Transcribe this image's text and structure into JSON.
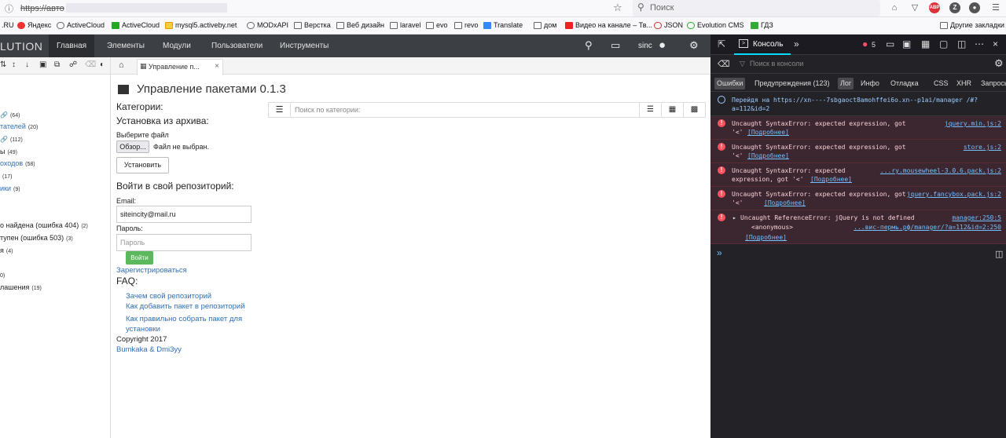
{
  "browser": {
    "url_prefix": "https://авто",
    "search_placeholder": "Поиск",
    "abp_badge": "ABP",
    "bookmarks": [
      ".RU",
      "Яндекс",
      "ActiveCloud",
      "ActiveCloud",
      "mysql5.activeby.net",
      "MODxAPI",
      "Верстка",
      "Веб дизайн",
      "laravel",
      "evo",
      "revo",
      "Translate",
      "дом",
      "Видео на канале – Тв...",
      "JSON",
      "Evolution CMS",
      "ГДЗ"
    ],
    "other_bookmarks": "Другие закладки"
  },
  "modx": {
    "logo": "LUTION",
    "nav": [
      "Главная",
      "Элементы",
      "Модули",
      "Пользователи",
      "Инструменты"
    ],
    "user": "sinc",
    "tab_title": "Управление п...",
    "tree": [
      {
        "text": "",
        "count": "(64)",
        "link": false
      },
      {
        "text": "тателей",
        "count": "(20)",
        "link": true
      },
      {
        "text": "",
        "count": "(112)",
        "link": false
      },
      {
        "text": "ы",
        "count": "(49)",
        "link": false
      },
      {
        "text": "оходов",
        "count": "(58)",
        "link": true
      },
      {
        "text": "",
        "count": "(17)",
        "link": false
      },
      {
        "text": "ики",
        "count": "(9)",
        "link": true
      },
      {
        "text": "о найдена (ошибка 404)",
        "count": "(2)",
        "link": false
      },
      {
        "text": "тупен (ошибка 503)",
        "count": "(3)",
        "link": false
      },
      {
        "text": "я",
        "count": "(4)",
        "link": false
      },
      {
        "text": "",
        "count": "0)",
        "link": false
      },
      {
        "text": "лашения",
        "count": "(19)",
        "link": false
      }
    ]
  },
  "main": {
    "title": "Управление пакетами 0.1.3",
    "categories_label": "Категории:",
    "install_archive_label": "Установка из архива:",
    "choose_file_label": "Выберите файл",
    "browse_button": "Обзор...",
    "no_file_text": "Файл не выбран.",
    "install_button": "Установить",
    "login_heading": "Войти в свой репозиторий:",
    "email_label": "Email:",
    "email_value": "siteincity@mail.ru",
    "password_label": "Пароль:",
    "password_placeholder": "Пароль",
    "login_button": "Войти",
    "register_link": "Зарегистрироваться",
    "faq_heading": "FAQ:",
    "faq_links": [
      "Зачем свой репозиторий",
      "Как добавить пакет в репозиторий",
      "Как правильно собрать пакет для установки"
    ],
    "copyright": "Copyright 2017",
    "authors_link": "Bumkaka & Dmi3yy",
    "category_search_placeholder": "Поиск по категории:"
  },
  "devtools": {
    "tab_console": "Консоль",
    "error_count": "5",
    "filter_placeholder": "Поиск в консоли",
    "filters": [
      "Ошибки",
      "Предупреждения (123)",
      "Лог",
      "Инфо",
      "Отладка",
      "CSS",
      "XHR",
      "Запросы"
    ],
    "messages": [
      {
        "type": "info",
        "text": "Перейдя на https://xn----7sbgaoct8amohffei6o.xn--p1ai/manager /#?a=112&id=2",
        "source": "",
        "more": ""
      },
      {
        "type": "error",
        "text": "Uncaught SyntaxError: expected expression, got '<'",
        "source": "jquery.min.js:2",
        "more": "[Подробнее]"
      },
      {
        "type": "error",
        "text": "Uncaught SyntaxError: expected expression, got '<'",
        "source": "store.js:2",
        "more": "[Подробнее]"
      },
      {
        "type": "error",
        "text": "Uncaught SyntaxError: expected expression, got '<'",
        "source": "...ry.mousewheel-3.0.6.pack.js:2",
        "more": "[Подробнее]"
      },
      {
        "type": "error",
        "text": "Uncaught SyntaxError: expected expression, got '<'",
        "source": "jquery.fancybox.pack.js:2",
        "more": "[Подробнее]"
      },
      {
        "type": "error",
        "text": "Uncaught ReferenceError: jQuery is not defined",
        "source": "manager:250:5",
        "anon": "<anonymous>",
        "anon_src": "...вис-пермь.рф/manager/?a=112&id=2:250",
        "more": "[Подробнее]"
      }
    ]
  }
}
